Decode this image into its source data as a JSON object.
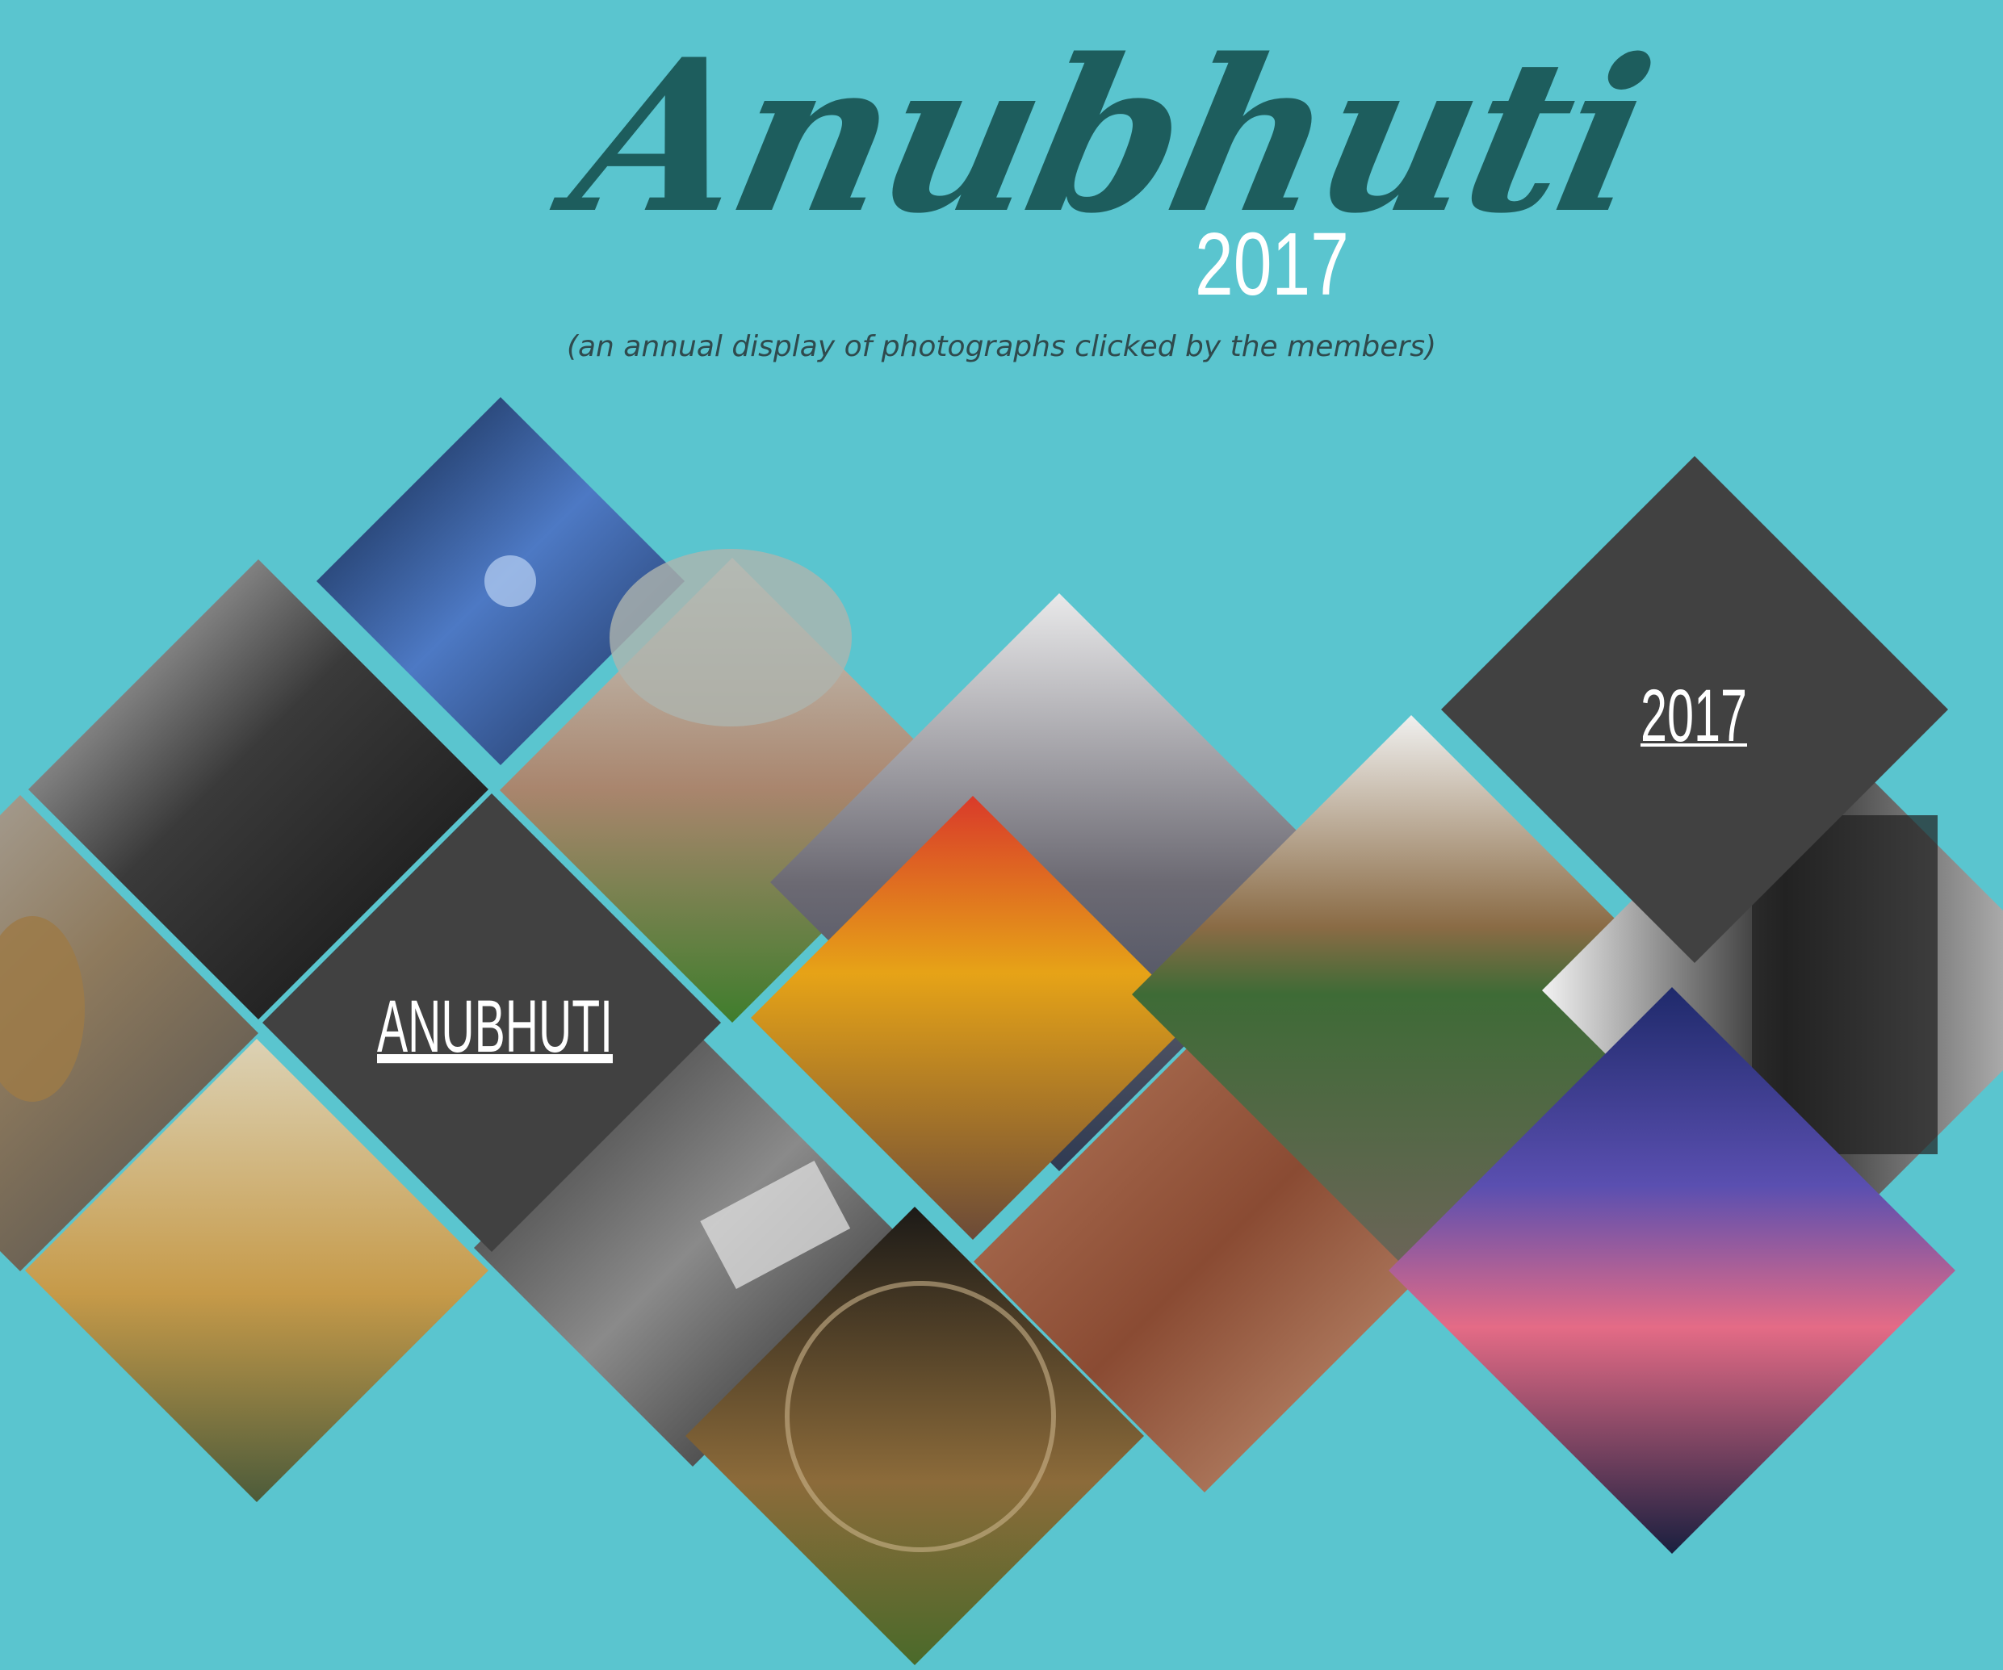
{
  "header": {
    "title": "Anubhuti",
    "year": "2017",
    "subtitle": "(an annual display of photographs clicked by the members)"
  },
  "tiles": {
    "anubhuti_label": "ANUBHUTI",
    "year_label": "2017"
  },
  "colors": {
    "background": "#5ac5cf",
    "title": "#1d5d5d",
    "dark_tile": "#414141",
    "label_text": "#ffffff"
  }
}
